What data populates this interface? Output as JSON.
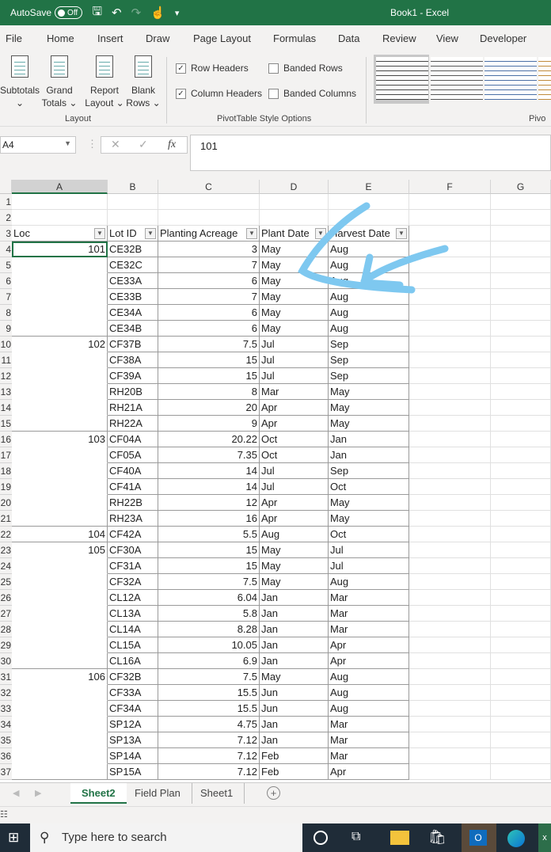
{
  "titlebar": {
    "autosave": "AutoSave",
    "toggle": "Off",
    "title": "Book1  -  Excel"
  },
  "menu": [
    "File",
    "Home",
    "Insert",
    "Draw",
    "Page Layout",
    "Formulas",
    "Data",
    "Review",
    "View",
    "Developer"
  ],
  "ribbon": {
    "subtotals": "Subtotals",
    "grand": "Grand",
    "totals": "Totals",
    "report": "Report",
    "layout_btn": "Layout",
    "blank": "Blank",
    "rows": "Rows",
    "layout_group": "Layout",
    "row_headers": "Row Headers",
    "column_headers": "Column Headers",
    "banded_rows": "Banded Rows",
    "banded_columns": "Banded Columns",
    "style_group": "PivotTable Style Options",
    "styles_group": "Pivo",
    "row_headers_checked": true,
    "column_headers_checked": true,
    "banded_rows_checked": false,
    "banded_columns_checked": false
  },
  "formula": {
    "name_box": "A4",
    "fx": "fx",
    "value": "101"
  },
  "columns": [
    "A",
    "B",
    "C",
    "D",
    "E",
    "F",
    "G"
  ],
  "table": {
    "headers": [
      "Loc",
      "Lot ID",
      "Planting Acreage",
      "Plant Date",
      "Harvest Date"
    ],
    "rows": [
      [
        "101",
        "CE32B",
        "3",
        "May",
        "Aug"
      ],
      [
        "",
        "CE32C",
        "7",
        "May",
        "Aug"
      ],
      [
        "",
        "CE33A",
        "6",
        "May",
        "Aug"
      ],
      [
        "",
        "CE33B",
        "7",
        "May",
        "Aug"
      ],
      [
        "",
        "CE34A",
        "6",
        "May",
        "Aug"
      ],
      [
        "",
        "CE34B",
        "6",
        "May",
        "Aug"
      ],
      [
        "102",
        "CF37B",
        "7.5",
        "Jul",
        "Sep"
      ],
      [
        "",
        "CF38A",
        "15",
        "Jul",
        "Sep"
      ],
      [
        "",
        "CF39A",
        "15",
        "Jul",
        "Sep"
      ],
      [
        "",
        "RH20B",
        "8",
        "Mar",
        "May"
      ],
      [
        "",
        "RH21A",
        "20",
        "Apr",
        "May"
      ],
      [
        "",
        "RH22A",
        "9",
        "Apr",
        "May"
      ],
      [
        "103",
        "CF04A",
        "20.22",
        "Oct",
        "Jan"
      ],
      [
        "",
        "CF05A",
        "7.35",
        "Oct",
        "Jan"
      ],
      [
        "",
        "CF40A",
        "14",
        "Jul",
        "Sep"
      ],
      [
        "",
        "CF41A",
        "14",
        "Jul",
        "Oct"
      ],
      [
        "",
        "RH22B",
        "12",
        "Apr",
        "May"
      ],
      [
        "",
        "RH23A",
        "16",
        "Apr",
        "May"
      ],
      [
        "104",
        "CF42A",
        "5.5",
        "Aug",
        "Oct"
      ],
      [
        "105",
        "CF30A",
        "15",
        "May",
        "Jul"
      ],
      [
        "",
        "CF31A",
        "15",
        "May",
        "Jul"
      ],
      [
        "",
        "CF32A",
        "7.5",
        "May",
        "Aug"
      ],
      [
        "",
        "CL12A",
        "6.04",
        "Jan",
        "Mar"
      ],
      [
        "",
        "CL13A",
        "5.8",
        "Jan",
        "Mar"
      ],
      [
        "",
        "CL14A",
        "8.28",
        "Jan",
        "Mar"
      ],
      [
        "",
        "CL15A",
        "10.05",
        "Jan",
        "Apr"
      ],
      [
        "",
        "CL16A",
        "6.9",
        "Jan",
        "Apr"
      ],
      [
        "106",
        "CF32B",
        "7.5",
        "May",
        "Aug"
      ],
      [
        "",
        "CF33A",
        "15.5",
        "Jun",
        "Aug"
      ],
      [
        "",
        "CF34A",
        "15.5",
        "Jun",
        "Aug"
      ],
      [
        "",
        "SP12A",
        "4.75",
        "Jan",
        "Mar"
      ],
      [
        "",
        "SP13A",
        "7.12",
        "Jan",
        "Mar"
      ],
      [
        "",
        "SP14A",
        "7.12",
        "Feb",
        "Mar"
      ],
      [
        "",
        "SP15A",
        "7.12",
        "Feb",
        "Apr"
      ]
    ]
  },
  "sheets": [
    "Sheet2",
    "Field Plan",
    "Sheet1"
  ],
  "taskbar": {
    "search_placeholder": "Type here to search"
  },
  "colors": {
    "excel_green": "#217346",
    "annotation": "#7ec8f0"
  }
}
